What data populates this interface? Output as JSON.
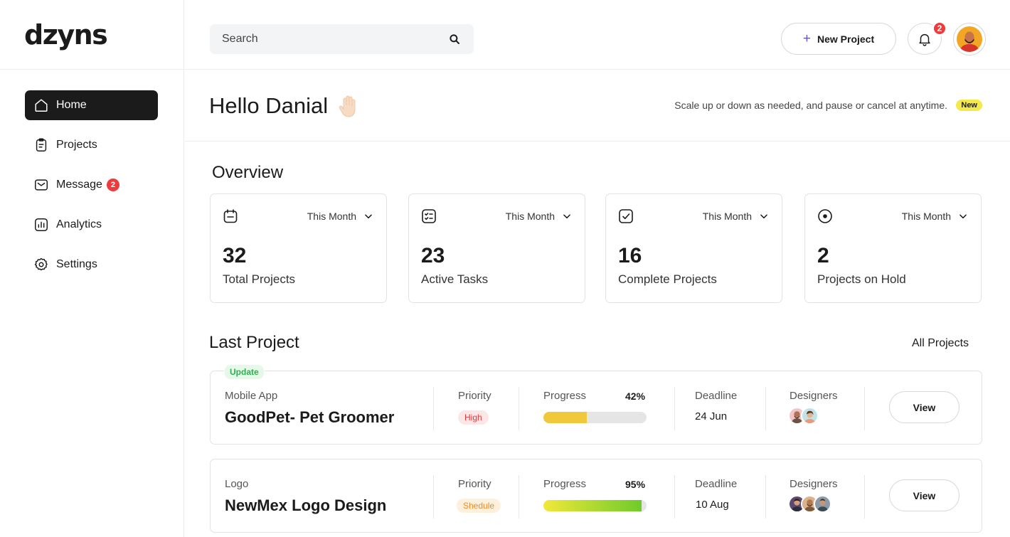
{
  "brand": {
    "logo_text": "dzyns"
  },
  "sidebar": {
    "items": [
      {
        "label": "Home",
        "icon": "home-icon",
        "active": true
      },
      {
        "label": "Projects",
        "icon": "clipboard-icon",
        "active": false
      },
      {
        "label": "Message",
        "icon": "mail-icon",
        "active": false,
        "badge": "2"
      },
      {
        "label": "Analytics",
        "icon": "analytics-icon",
        "active": false
      },
      {
        "label": "Settings",
        "icon": "gear-icon",
        "active": false
      }
    ]
  },
  "topbar": {
    "search_placeholder": "Search",
    "new_project_label": "New Project",
    "notification_count": "2"
  },
  "greeting": {
    "title": "Hello Danial",
    "note": "Scale up or down as needed, and pause or cancel at anytime.",
    "badge": "New"
  },
  "overview": {
    "title": "Overview",
    "cards": [
      {
        "icon": "calendar-icon",
        "filter": "This Month",
        "value": "32",
        "label": "Total Projects"
      },
      {
        "icon": "checklist-icon",
        "filter": "This Month",
        "value": "23",
        "label": "Active Tasks"
      },
      {
        "icon": "check-square-icon",
        "filter": "This Month",
        "value": "16",
        "label": "Complete Projects"
      },
      {
        "icon": "pause-circle-icon",
        "filter": "This Month",
        "value": "2",
        "label": "Projects on Hold"
      }
    ]
  },
  "last_project": {
    "title": "Last Project",
    "all_projects_label": "All Projects",
    "update_badge": "Update",
    "columns": {
      "priority": "Priority",
      "progress": "Progress",
      "deadline": "Deadline",
      "designers": "Designers"
    },
    "view_label": "View",
    "projects": [
      {
        "category": "Mobile App",
        "name": "GoodPet- Pet Groomer",
        "priority": "High",
        "progress_label": "42%",
        "progress": 0.42,
        "deadline": "24 Jun",
        "designer_count": 2
      },
      {
        "category": "Logo",
        "name": "NewMex Logo Design",
        "priority": "Shedule",
        "progress_label": "95%",
        "progress": 0.95,
        "deadline": "10 Aug",
        "designer_count": 3
      }
    ]
  },
  "colors": {
    "accent_dark": "#1b1b1b",
    "badge_red": "#ee3b3b",
    "plus_purple": "#6b4de6",
    "progress_yellow": "#f0c93a",
    "progress_green": "#7ccf2a"
  }
}
